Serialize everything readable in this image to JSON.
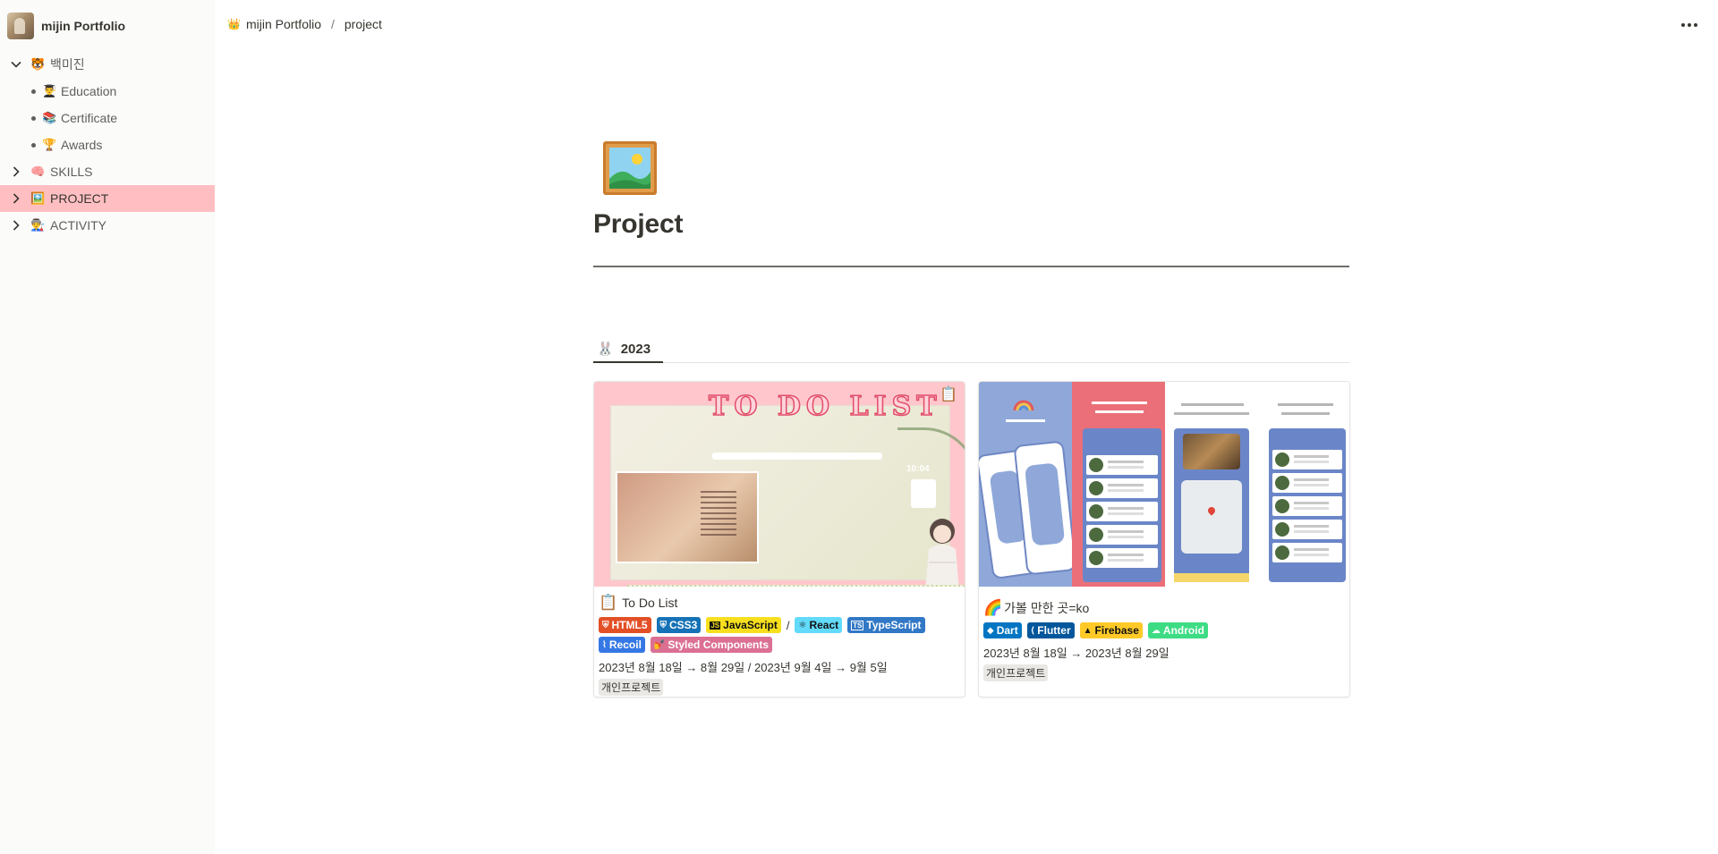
{
  "workspace": {
    "name": "mijin Portfolio"
  },
  "sidebar": {
    "items": [
      {
        "emoji": "🐯",
        "label": "백미진",
        "level": 0,
        "toggle": "expanded"
      },
      {
        "emoji": "👨‍🎓",
        "label": "Education",
        "level": 1
      },
      {
        "emoji": "📚",
        "label": "Certificate",
        "level": 1
      },
      {
        "emoji": "🏆",
        "label": "Awards",
        "level": 1
      },
      {
        "emoji": "🧠",
        "label": "SKILLS",
        "level": 0,
        "toggle": "collapsed"
      },
      {
        "emoji": "🖼️",
        "label": "PROJECT",
        "level": 0,
        "toggle": "collapsed",
        "active": true
      },
      {
        "emoji": "👨‍🏭",
        "label": "ACTIVITY",
        "level": 0,
        "toggle": "collapsed"
      }
    ],
    "active_color": "#ffbfc2"
  },
  "breadcrumb": {
    "workspace_icon": "👑",
    "workspace": "mijin Portfolio",
    "separator": "/",
    "page": "project"
  },
  "page": {
    "icon": "framed-picture-icon",
    "title": "Project"
  },
  "section": {
    "emoji": "🐰",
    "year_tab": "2023"
  },
  "cards": [
    {
      "emoji": "📋",
      "title": "To Do List",
      "cover_text": "TO DO LIST",
      "tags_line1": [
        {
          "label": "HTML5",
          "bg": "#e34f26",
          "icon": "html5-icon"
        },
        {
          "label": "CSS3",
          "bg": "#1572b6",
          "icon": "css3-icon"
        },
        {
          "label": "JavaScript",
          "bg": "#f7df1e",
          "color": "#111111",
          "icon": "javascript-icon"
        }
      ],
      "slash": "/",
      "tags_line1b": [
        {
          "label": "React",
          "bg": "#61dafb",
          "color": "#111111",
          "icon": "react-icon"
        },
        {
          "label": "TypeScript",
          "bg": "#3178c6",
          "icon": "typescript-icon"
        }
      ],
      "tags_line2": [
        {
          "label": "Recoil",
          "bg": "#3578e5",
          "icon": "recoil-icon"
        },
        {
          "label": "Styled Components",
          "bg": "#db7093",
          "icon": "styled-components-icon"
        }
      ],
      "date": "2023년 8월 18일 → 8월 29일 / 2023년 9월 4일 → 9월 5일",
      "label": "개인프로젝트"
    },
    {
      "emoji": "🌈",
      "title": "가볼 만한 곳=ko",
      "tags_line1": [
        {
          "label": "Dart",
          "bg": "#0175c2",
          "icon": "dart-icon"
        },
        {
          "label": "Flutter",
          "bg": "#02569b",
          "icon": "flutter-icon"
        },
        {
          "label": "Firebase",
          "bg": "#ffca28",
          "color": "#111111",
          "icon": "firebase-icon"
        },
        {
          "label": "Android",
          "bg": "#3ddc84",
          "icon": "android-icon"
        }
      ],
      "date": "2023년 8월 18일 → 2023년 8월 29일",
      "label": "개인프로젝트"
    }
  ],
  "colors": {
    "sidebar_bg": "#fbfbfa",
    "text": "#37352f",
    "todo_cover_bg": "#ffc7cc"
  }
}
